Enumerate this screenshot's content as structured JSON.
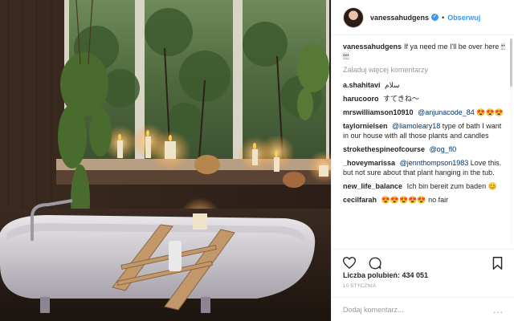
{
  "post": {
    "username": "vanessahudgens",
    "follow_label": "Obserwuj",
    "caption_user": "vanessahudgens",
    "caption_text": "If ya need me I'll be over here 🕯🕯🕯🕯🕯"
  },
  "comments": {
    "load_more_label": "Załaduj więcej komentarzy",
    "items": [
      {
        "user": "a.shahitavi",
        "text": "سلام"
      },
      {
        "user": "harucooro",
        "text": "すてきね〜"
      },
      {
        "user": "mrswilliamson10910",
        "mention": "@anjunacode_84",
        "text": "😍😍😍"
      },
      {
        "user": "taylornielsen",
        "mention": "@liamoleary18",
        "text": "type of bath I want in our house with all those plants and candles"
      },
      {
        "user": "strokethespineofcourse",
        "mention": "@og_fl0",
        "text": ""
      },
      {
        "user": "_hoveymarissa",
        "mention": "@jennthompson1983",
        "text": "Love this. but not sure about that plant hanging in the tub."
      },
      {
        "user": "new_life_balance",
        "text": "Ich bin bereit zum baden 😊"
      },
      {
        "user": "cecilfarah",
        "text": "😍😍😍😍😍 no fair"
      }
    ]
  },
  "actions": {
    "like_icon": "heart-icon",
    "comment_icon": "comment-bubble-icon",
    "save_icon": "bookmark-icon"
  },
  "likes_label": "Liczba polubień: 434 051",
  "date_label": "10 STYCZNIA",
  "add_comment_placeholder": "Dodaj komentarz...",
  "more_label": "...",
  "colors": {
    "accent": "#3897f0",
    "mention": "#003569",
    "muted": "#999999",
    "border": "#efefef"
  }
}
